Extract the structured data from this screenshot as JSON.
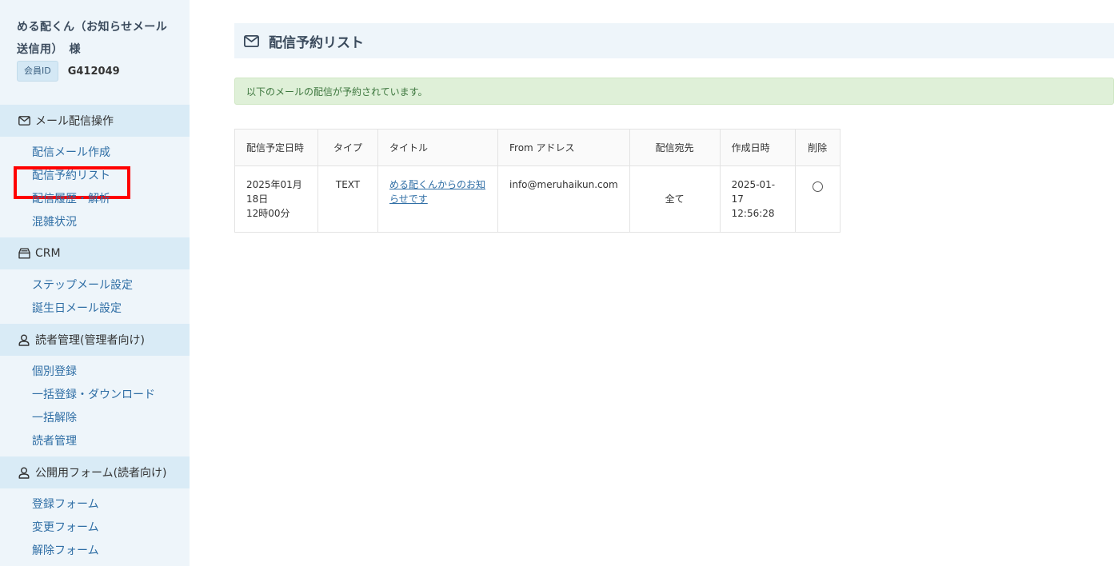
{
  "user": {
    "name_line1": "める配くん（お知らせメール",
    "name_line2": "送信用）　様",
    "member_badge": "会員ID",
    "member_id": "G412049"
  },
  "sidebar": {
    "sections": [
      {
        "title": "メール配信操作",
        "icon": "mail-icon",
        "items": [
          "配信メール作成",
          "配信予約リスト",
          "配信履歴・解析",
          "混雑状況"
        ]
      },
      {
        "title": "CRM",
        "icon": "inbox-icon",
        "items": [
          "ステップメール設定",
          "誕生日メール設定"
        ]
      },
      {
        "title": "読者管理(管理者向け)",
        "icon": "person-icon",
        "items": [
          "個別登録",
          "一括登録・ダウンロード",
          "一括解除",
          "読者管理"
        ]
      },
      {
        "title": "公開用フォーム(読者向け)",
        "icon": "person-icon",
        "items": [
          "登録フォーム",
          "変更フォーム",
          "解除フォーム"
        ]
      }
    ],
    "active_item": "配信予約リスト"
  },
  "main": {
    "title": "配信予約リスト",
    "alert": "以下のメールの配信が予約されています。",
    "table": {
      "headers": [
        "配信予定日時",
        "タイプ",
        "タイトル",
        "From アドレス",
        "配信宛先",
        "作成日時",
        "削除"
      ],
      "rows": [
        {
          "date_line1": "2025年01月",
          "date_line2": "18日",
          "date_line3": "12時00分",
          "type": "TEXT",
          "title_line1": "める配くんからのお知",
          "title_line2": "らせです",
          "from": "info@meruhaikun.com",
          "recipients": "全て",
          "created_date": "2025-01-17",
          "created_time": "12:56:28"
        }
      ]
    }
  }
}
